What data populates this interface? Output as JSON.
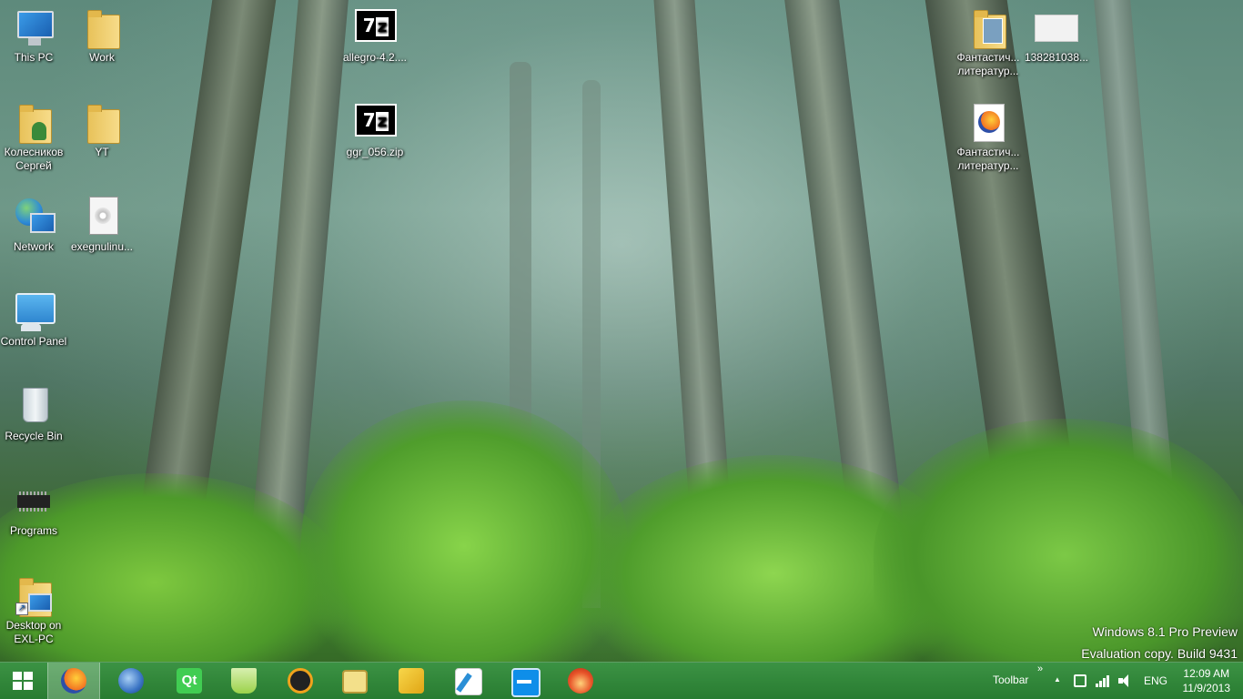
{
  "desktop": {
    "icons_left": [
      {
        "label": "This PC",
        "icon": "computer-icon"
      },
      {
        "label": "Колесников Сергей",
        "icon": "user-folder-icon"
      },
      {
        "label": "Network",
        "icon": "network-icon"
      },
      {
        "label": "Control Panel",
        "icon": "control-panel-icon"
      },
      {
        "label": "Recycle Bin",
        "icon": "recycle-bin-icon"
      },
      {
        "label": "Programs",
        "icon": "chip-icon"
      },
      {
        "label": "Desktop on EXL-PC",
        "icon": "network-folder-icon"
      }
    ],
    "icons_col2": [
      {
        "label": "Work",
        "icon": "folder-icon"
      },
      {
        "label": "YT",
        "icon": "folder-icon"
      },
      {
        "label": "exegnulinu...",
        "icon": "disc-image-icon"
      }
    ],
    "icons_col3": [
      {
        "label": "allegro-4.2....",
        "icon": "7z-archive-icon"
      },
      {
        "label": "ggr_056.zip",
        "icon": "7z-archive-icon"
      }
    ],
    "icons_right": [
      {
        "label": "Фантастич... литератур...",
        "icon": "folder-icon"
      },
      {
        "label": "138281038...",
        "icon": "image-thumbnail-icon"
      },
      {
        "label": "Фантастич... литератур...",
        "icon": "firefox-document-icon"
      }
    ]
  },
  "watermark": {
    "line1": "Windows 8.1 Pro Preview",
    "line2": "Evaluation copy. Build 9431"
  },
  "taskbar": {
    "start_icon": "windows-logo-icon",
    "apps": [
      {
        "name": "firefox-icon",
        "active": true,
        "color": "#f27322"
      },
      {
        "name": "thunderbird-icon",
        "active": false,
        "color": "#3a74c4"
      },
      {
        "name": "qt-creator-icon",
        "active": false,
        "color": "#41cd52"
      },
      {
        "name": "network-meter-icon",
        "active": false,
        "color": "#9bd24a"
      },
      {
        "name": "aimp-icon",
        "active": false,
        "color": "#f0a21c"
      },
      {
        "name": "game-editor-icon",
        "active": false,
        "color": "#f3e08a"
      },
      {
        "name": "puzzle-tool-icon",
        "active": false,
        "color": "#f2c12e"
      },
      {
        "name": "quill-editor-icon",
        "active": false,
        "color": "#2a8fd6"
      },
      {
        "name": "teamviewer-icon",
        "active": false,
        "color": "#0e8ee9"
      },
      {
        "name": "burner-icon",
        "active": false,
        "color": "#e8542a"
      }
    ],
    "toolbar_label": "Toolbar",
    "toolbar_chevron": "»",
    "tray_up_arrow": "▲",
    "language": "ENG",
    "time": "12:09 AM",
    "date": "11/9/2013"
  }
}
